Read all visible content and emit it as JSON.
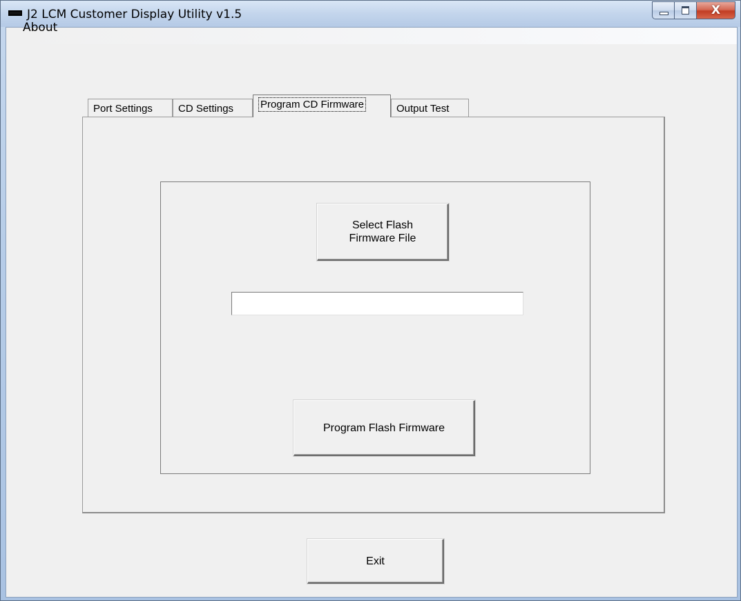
{
  "window": {
    "title": "J2 LCM Customer Display Utility v1.5",
    "controls": {
      "minimize": "minimize-icon",
      "maximize": "maximize-icon",
      "close": "X"
    }
  },
  "menu": {
    "items": [
      {
        "label": "About"
      }
    ]
  },
  "tabs": [
    {
      "label": "Port Settings",
      "selected": false
    },
    {
      "label": "CD Settings",
      "selected": false
    },
    {
      "label": "Program CD Firmware",
      "selected": true
    },
    {
      "label": "Output Test",
      "selected": false
    }
  ],
  "firmware_panel": {
    "select_button_label": "Select Flash\nFirmware File",
    "file_path_value": "",
    "program_button_label": "Program Flash Firmware"
  },
  "footer": {
    "exit_label": "Exit"
  },
  "colors": {
    "titlebar": "#c3d5ec",
    "client_background": "#f0f0f0",
    "close_button": "#c23d24"
  }
}
